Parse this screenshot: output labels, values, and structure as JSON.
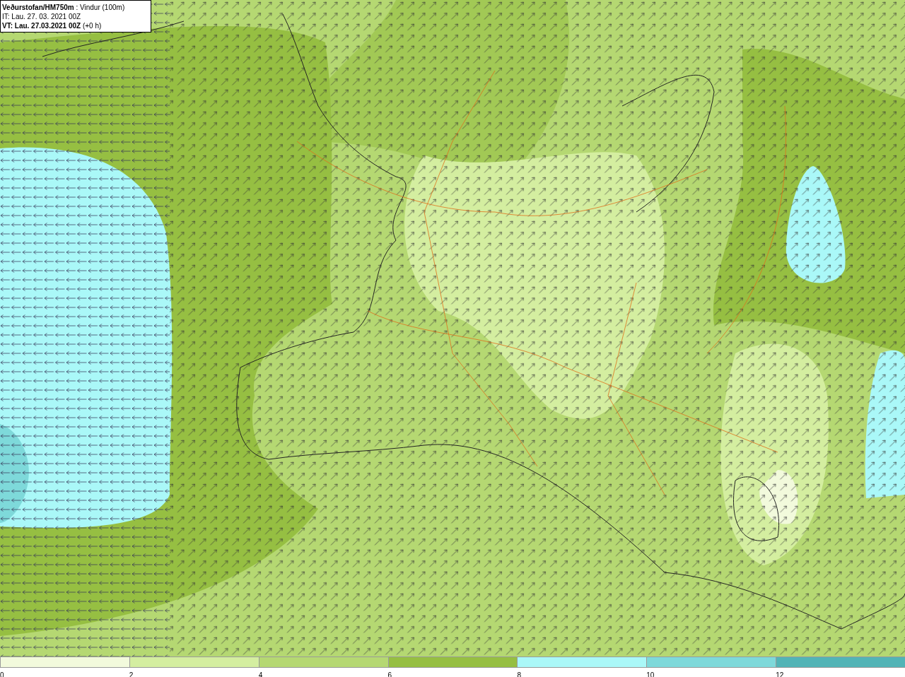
{
  "header": {
    "lines": [
      "**Veðurstofan/HM750m** : Vindur (100m)",
      "IT: Lau. 27. 03. 2021 00Z",
      "**VT: Lau. 27.03.2021 00Z** (+0 h)"
    ]
  },
  "legend": {
    "bins": [
      {
        "label": "0",
        "color": "#f2fadc"
      },
      {
        "label": "2",
        "color": "#d4eea0"
      },
      {
        "label": "4",
        "color": "#b5d872"
      },
      {
        "label": "6",
        "color": "#96bf42"
      },
      {
        "label": "8",
        "color": "#aaf8f8"
      },
      {
        "label": "10",
        "color": "#7ed9da"
      },
      {
        "label": "12",
        "color": "#52b4b6"
      }
    ]
  }
}
